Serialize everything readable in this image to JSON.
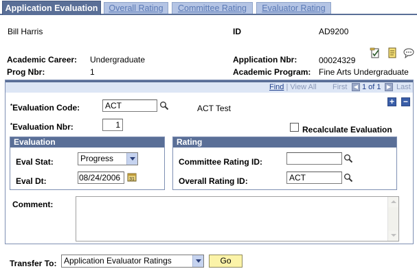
{
  "tabs": [
    {
      "label": "Application Evaluation",
      "active": true
    },
    {
      "label": "Overall Rating",
      "active": false
    },
    {
      "label": "Committee Rating",
      "active": false
    },
    {
      "label": "Evaluator Rating",
      "active": false
    }
  ],
  "header": {
    "name": "Bill Harris",
    "id_label": "ID",
    "id_value": "AD9200",
    "academic_career_label": "Academic Career:",
    "academic_career_value": "Undergraduate",
    "application_nbr_label": "Application Nbr:",
    "application_nbr_value": "00024329",
    "prog_nbr_label": "Prog Nbr:",
    "prog_nbr_value": "1",
    "academic_program_label": "Academic Program:",
    "academic_program_value": "Fine Arts Undergraduate",
    "icons": [
      "notepad-check-icon",
      "notes-icon",
      "comment-bubble-icon"
    ]
  },
  "nav": {
    "find": "Find",
    "separator": "|",
    "view_all": "View All",
    "first": "First",
    "page_info": "1 of 1",
    "last": "Last"
  },
  "form": {
    "eval_code_label": "Evaluation Code:",
    "eval_code_value": "ACT",
    "eval_code_desc": "ACT Test",
    "eval_nbr_label": "Evaluation Nbr:",
    "eval_nbr_value": "1",
    "required_marker": "*",
    "recalculate_label": "Recalculate Evaluation",
    "recalculate_checked": false,
    "add_symbol": "+",
    "remove_symbol": "−"
  },
  "evaluation": {
    "title": "Evaluation",
    "eval_stat_label": "Eval Stat:",
    "eval_stat_value": "Progress",
    "eval_dt_label": "Eval Dt:",
    "eval_dt_value": "08/24/2006"
  },
  "rating": {
    "title": "Rating",
    "committee_label": "Committee Rating ID:",
    "committee_value": "",
    "overall_label": "Overall Rating ID:",
    "overall_value": "ACT"
  },
  "comment": {
    "label": "Comment:",
    "value": ""
  },
  "transfer": {
    "label": "Transfer To:",
    "value": "Application Evaluator Ratings",
    "go_label": "Go"
  },
  "colors": {
    "tab_active": "#5a6f97",
    "tab_inactive": "#b4c4e4",
    "tab_inactive_text": "#5a79b5",
    "panel_header": "#5a6f97",
    "panel_subheader": "#dde6f5",
    "go_button": "#fbf3a8"
  }
}
